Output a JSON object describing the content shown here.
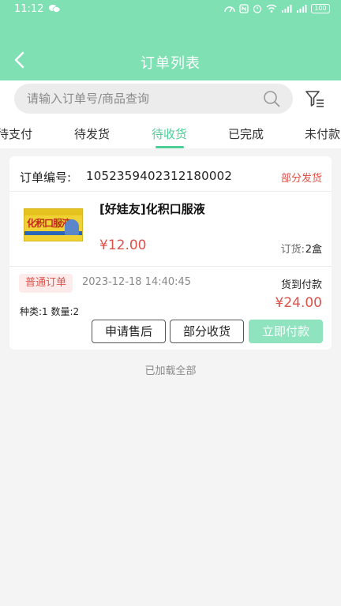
{
  "status_bar": {
    "time": "11:12",
    "battery": "100"
  },
  "nav": {
    "title": "订单列表"
  },
  "search": {
    "placeholder": "请输入订单号/商品查询",
    "value": ""
  },
  "tabs": [
    {
      "label": "待支付",
      "active": false
    },
    {
      "label": "待发货",
      "active": false
    },
    {
      "label": "待收货",
      "active": true
    },
    {
      "label": "已完成",
      "active": false
    },
    {
      "label": "未付款",
      "active": false
    }
  ],
  "order": {
    "number_label": "订单编号:",
    "number": "1052359402312180002",
    "status": "部分发货",
    "product": {
      "image_text": "化积口服液",
      "name": "[好娃友]化积口服液",
      "price": "¥12.00",
      "qty_label": "订货:",
      "qty_value": "2盒"
    },
    "type": "普通订单",
    "time": "2023-12-18 14:40:45",
    "pay_method": "货到付款",
    "kinds_qty": "种类:1  数量:2",
    "total": "¥24.00",
    "buttons": {
      "after_sale": "申请售后",
      "partial_receive": "部分收货",
      "pay_now": "立即付款"
    }
  },
  "footer": {
    "text": "已加载全部"
  },
  "colors": {
    "brand": "#7fe0b3",
    "active_tab": "#4fcf98",
    "price_red": "#e0514a",
    "primary_button": "#8fe3bf"
  }
}
